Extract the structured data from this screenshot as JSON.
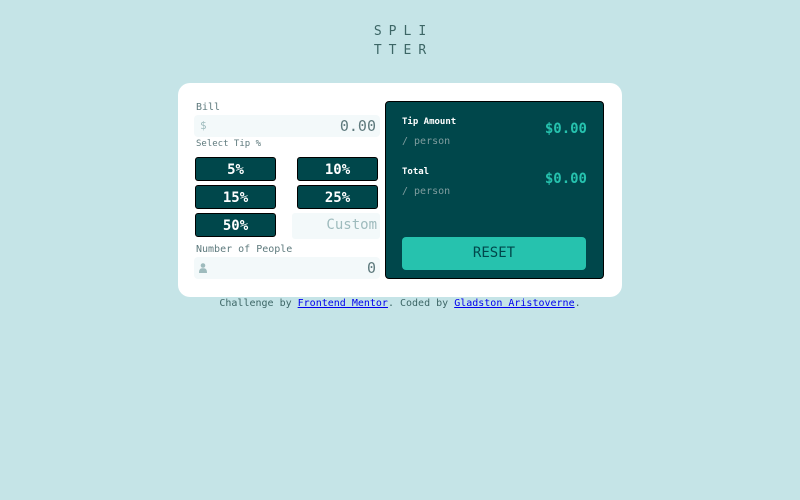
{
  "logo": {
    "line1": "SPLI",
    "line2": "TTER"
  },
  "bill": {
    "label": "Bill",
    "prefix": "$",
    "value": "0.00"
  },
  "tip": {
    "label": "Select Tip %",
    "options": [
      "5%",
      "10%",
      "15%",
      "25%",
      "50%"
    ],
    "custom_placeholder": "Custom"
  },
  "people": {
    "label": "Number of People",
    "value": "0",
    "icon": "person-icon"
  },
  "results": {
    "tip_amount_label": "Tip Amount",
    "tip_amount_sub": "/ person",
    "tip_amount_value": "$0.00",
    "total_label": "Total",
    "total_sub": "/ person",
    "total_value": "$0.00",
    "reset_label": "RESET"
  },
  "footer": {
    "prefix": "Challenge by ",
    "link1": "Frontend Mentor",
    "middle": ". Coded by ",
    "link2": "Gladston Aristoverne",
    "suffix": "."
  },
  "colors": {
    "background": "#c5e4e7",
    "dark_cyan": "#00474b",
    "strong_cyan": "#26c2ae",
    "card": "#ffffff",
    "input_bg": "#f3f9fa"
  }
}
